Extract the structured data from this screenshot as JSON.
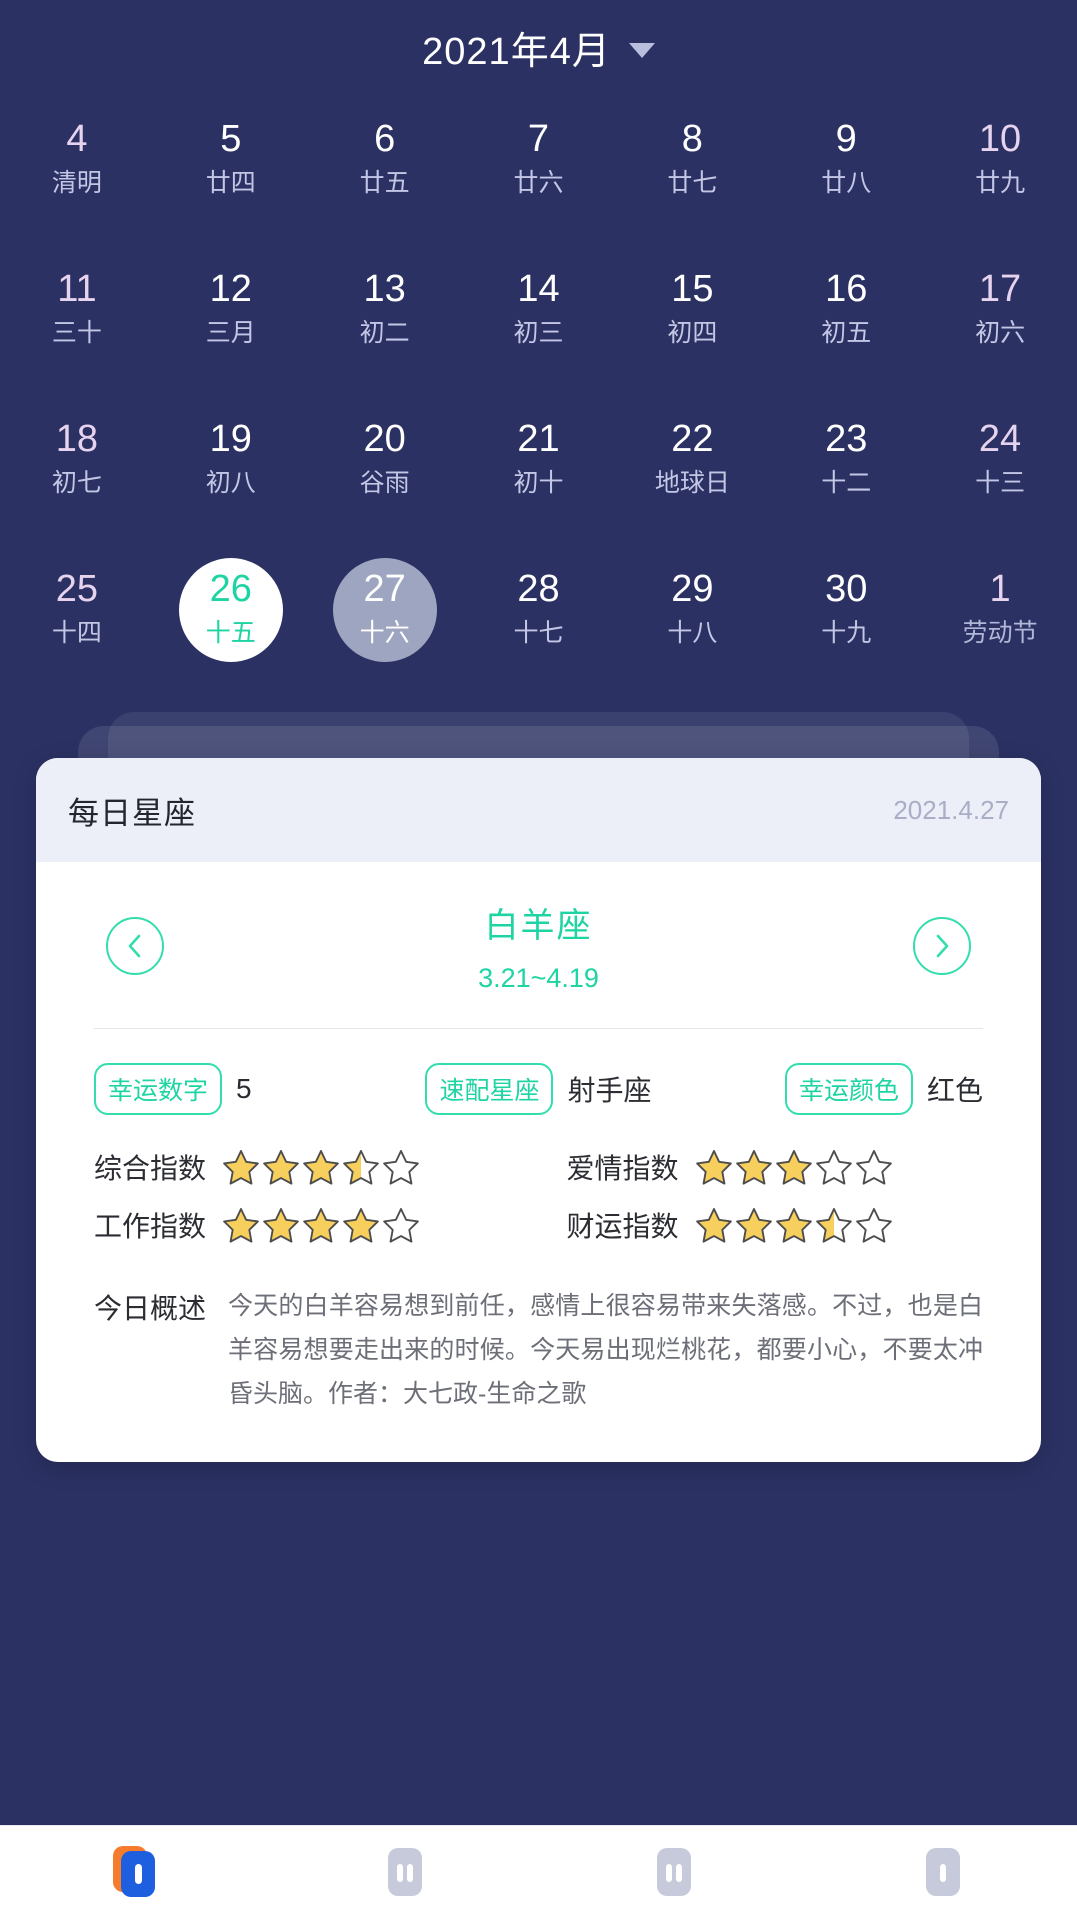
{
  "header": {
    "title": "2021年4月",
    "dropdown_icon": "chevron-down-icon"
  },
  "calendar": {
    "weeks": [
      [
        {
          "day": "4",
          "lunar": "清明",
          "weekend": true,
          "state": "normal"
        },
        {
          "day": "5",
          "lunar": "廿四",
          "weekend": false,
          "state": "normal"
        },
        {
          "day": "6",
          "lunar": "廿五",
          "weekend": false,
          "state": "normal"
        },
        {
          "day": "7",
          "lunar": "廿六",
          "weekend": false,
          "state": "normal"
        },
        {
          "day": "8",
          "lunar": "廿七",
          "weekend": false,
          "state": "normal"
        },
        {
          "day": "9",
          "lunar": "廿八",
          "weekend": false,
          "state": "normal"
        },
        {
          "day": "10",
          "lunar": "廿九",
          "weekend": true,
          "state": "normal"
        }
      ],
      [
        {
          "day": "11",
          "lunar": "三十",
          "weekend": true,
          "state": "normal"
        },
        {
          "day": "12",
          "lunar": "三月",
          "weekend": false,
          "state": "normal"
        },
        {
          "day": "13",
          "lunar": "初二",
          "weekend": false,
          "state": "normal"
        },
        {
          "day": "14",
          "lunar": "初三",
          "weekend": false,
          "state": "normal"
        },
        {
          "day": "15",
          "lunar": "初四",
          "weekend": false,
          "state": "normal"
        },
        {
          "day": "16",
          "lunar": "初五",
          "weekend": false,
          "state": "normal"
        },
        {
          "day": "17",
          "lunar": "初六",
          "weekend": true,
          "state": "normal"
        }
      ],
      [
        {
          "day": "18",
          "lunar": "初七",
          "weekend": true,
          "state": "normal"
        },
        {
          "day": "19",
          "lunar": "初八",
          "weekend": false,
          "state": "normal"
        },
        {
          "day": "20",
          "lunar": "谷雨",
          "weekend": false,
          "state": "normal"
        },
        {
          "day": "21",
          "lunar": "初十",
          "weekend": false,
          "state": "normal"
        },
        {
          "day": "22",
          "lunar": "地球日",
          "weekend": false,
          "state": "normal"
        },
        {
          "day": "23",
          "lunar": "十二",
          "weekend": false,
          "state": "normal"
        },
        {
          "day": "24",
          "lunar": "十三",
          "weekend": true,
          "state": "normal"
        }
      ],
      [
        {
          "day": "25",
          "lunar": "十四",
          "weekend": true,
          "state": "normal"
        },
        {
          "day": "26",
          "lunar": "十五",
          "weekend": false,
          "state": "today"
        },
        {
          "day": "27",
          "lunar": "十六",
          "weekend": false,
          "state": "selected"
        },
        {
          "day": "28",
          "lunar": "十七",
          "weekend": false,
          "state": "normal"
        },
        {
          "day": "29",
          "lunar": "十八",
          "weekend": false,
          "state": "normal"
        },
        {
          "day": "30",
          "lunar": "十九",
          "weekend": false,
          "state": "normal"
        },
        {
          "day": "1",
          "lunar": "劳动节",
          "weekend": true,
          "state": "outside"
        }
      ]
    ]
  },
  "horoscope_card": {
    "title": "每日星座",
    "date": "2021.4.27",
    "prev_icon": "chevron-left-icon",
    "next_icon": "chevron-right-icon",
    "sign_name": "白羊座",
    "sign_range": "3.21~4.19",
    "lucky": [
      {
        "label": "幸运数字",
        "value": "5"
      },
      {
        "label": "速配星座",
        "value": "射手座"
      },
      {
        "label": "幸运颜色",
        "value": "红色"
      }
    ],
    "ratings": [
      {
        "label": "综合指数",
        "stars": 3.5,
        "max": 5
      },
      {
        "label": "爱情指数",
        "stars": 3,
        "max": 5
      },
      {
        "label": "工作指数",
        "stars": 4,
        "max": 5
      },
      {
        "label": "财运指数",
        "stars": 3.5,
        "max": 5
      }
    ],
    "summary_label": "今日概述",
    "summary_text": "今天的白羊容易想到前任，感情上很容易带来失落感。不过，也是白羊容易想要走出来的时候。今天易出现烂桃花，都要小心，不要太冲昏头脑。作者：大七政-生命之歌"
  },
  "bottom_nav": {
    "items": [
      {
        "icon": "calendar-app-icon",
        "active": true
      },
      {
        "icon": "grid-icon",
        "active": false
      },
      {
        "icon": "grid-icon",
        "active": false
      },
      {
        "icon": "profile-icon",
        "active": false
      }
    ]
  },
  "colors": {
    "background": "#2b3163",
    "accent_green": "#1fd4a3",
    "weekend_text": "#e6d3ee",
    "card_header": "#eceef8",
    "star_gold": "#f7cf5c"
  }
}
